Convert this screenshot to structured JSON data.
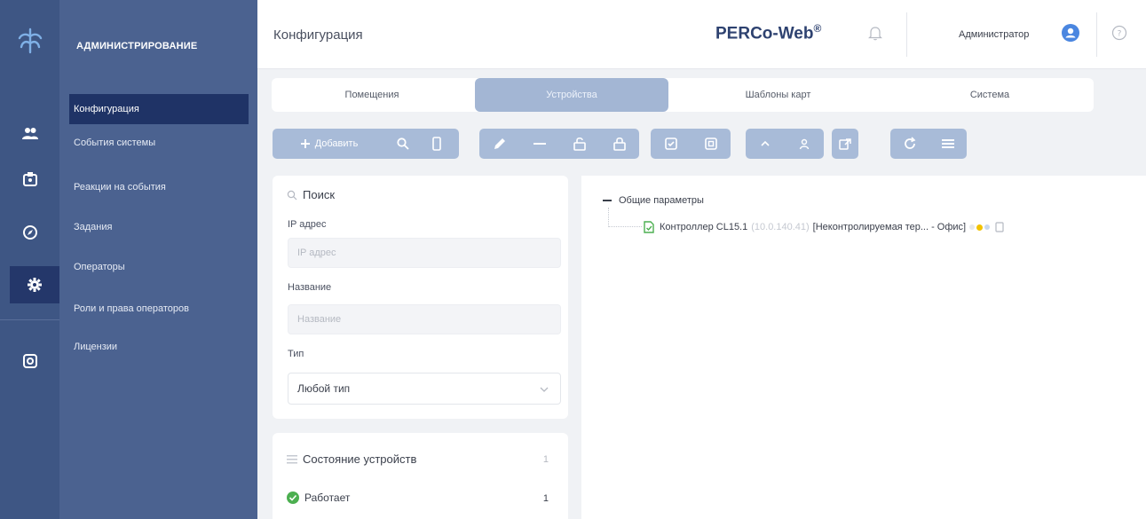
{
  "app": {
    "page_title": "Конфигурация",
    "brand": "PERCo-Web",
    "brand_mark": "®",
    "user_name": "Администратор"
  },
  "sidebar": {
    "heading": "АДМИНИСТРИРОВАНИЕ",
    "items": [
      {
        "label": "Конфигурация",
        "active": true
      },
      {
        "label": "События системы",
        "active": false
      },
      {
        "label": "Реакции на события",
        "active": false
      },
      {
        "label": "Задания",
        "active": false
      },
      {
        "label": "Операторы",
        "active": false
      },
      {
        "label": "Роли и права операторов",
        "active": false
      },
      {
        "label": "Лицензии",
        "active": false
      }
    ]
  },
  "rail": {
    "icons": [
      "logo-icon",
      "users-icon",
      "badge-icon",
      "compass-icon",
      "gear-icon",
      "camera-icon"
    ],
    "active": "gear-icon"
  },
  "tabs": [
    {
      "label": "Помещения",
      "active": false
    },
    {
      "label": "Устройства",
      "active": true
    },
    {
      "label": "Шаблоны карт",
      "active": false
    },
    {
      "label": "Система",
      "active": false
    }
  ],
  "toolbar": {
    "add_label": "Добавить"
  },
  "filters": {
    "search_placeholder": "Поиск",
    "ip_label": "IP адрес",
    "ip_placeholder": "IP адрес",
    "name_label": "Название",
    "name_placeholder": "Название",
    "type_label": "Тип",
    "type_value": "Любой тип"
  },
  "status_panel": {
    "title": "Состояние устройств",
    "title_count": "1",
    "items": [
      {
        "label": "Работает",
        "count": "1"
      }
    ]
  },
  "tree": {
    "group_label": "Общие параметры",
    "device_name": "Контроллер CL15.1",
    "device_ip": "(10.0.140.41)",
    "device_zone": "[Неконтролируемая тер... - Офис]",
    "colors": {
      "ok": "#4caf50",
      "warn": "#f2c200",
      "link": "#3e5684"
    }
  },
  "colors": {
    "rail": "#3e5684",
    "sidebar": "#4b6290",
    "active_item": "#1f3366",
    "toolbar": "#a8bbd8"
  }
}
